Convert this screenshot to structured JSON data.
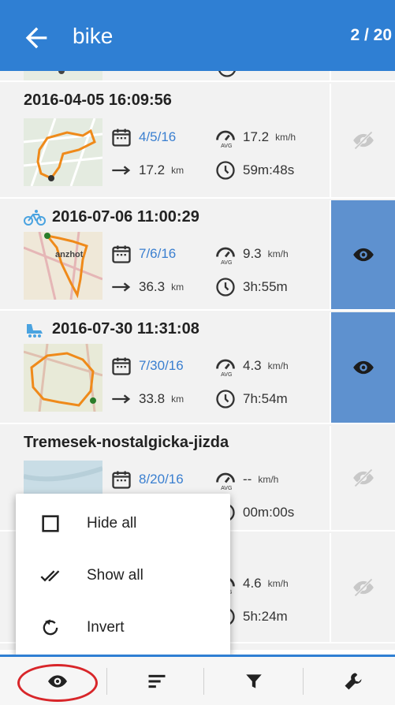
{
  "header": {
    "title": "bike",
    "count": "2 / 20"
  },
  "tracks": [
    {
      "title": "",
      "date": "",
      "speed": "",
      "speed_unit": "",
      "distance": "",
      "distance_unit": "",
      "duration": "",
      "visible": false,
      "partial": true
    },
    {
      "title": "2016-04-05 16:09:56",
      "activity": "",
      "date": "4/5/16",
      "speed": "17.2",
      "speed_unit": "km/h",
      "distance": "17.2",
      "distance_unit": "km",
      "duration": "59m:48s",
      "visible": false
    },
    {
      "title": "2016-07-06 11:00:29",
      "activity": "bike",
      "date": "7/6/16",
      "speed": "9.3",
      "speed_unit": "km/h",
      "distance": "36.3",
      "distance_unit": "km",
      "duration": "3h:55m",
      "visible": true
    },
    {
      "title": "2016-07-30 11:31:08",
      "activity": "skate",
      "date": "7/30/16",
      "speed": "4.3",
      "speed_unit": "km/h",
      "distance": "33.8",
      "distance_unit": "km",
      "duration": "7h:54m",
      "visible": true
    },
    {
      "title": "Tremesek-nostalgicka-jizda",
      "activity": "",
      "date": "8/20/16",
      "speed": "--",
      "speed_unit": "km/h",
      "distance": "",
      "distance_unit": "",
      "duration": "00m:00s",
      "visible": false
    },
    {
      "title": "",
      "activity": "",
      "date": "",
      "speed": "4.6",
      "speed_unit": "km/h",
      "distance": "",
      "distance_unit": "",
      "duration": "5h:24m",
      "visible": false
    }
  ],
  "popup_menu": [
    {
      "label": "Hide all",
      "icon": "checkbox-blank-icon"
    },
    {
      "label": "Show all",
      "icon": "double-check-icon"
    },
    {
      "label": "Invert",
      "icon": "invert-icon"
    }
  ],
  "bottom_bar": [
    {
      "name": "visibility",
      "icon": "eye-icon",
      "active": true
    },
    {
      "name": "sort",
      "icon": "sort-icon"
    },
    {
      "name": "filter",
      "icon": "filter-icon"
    },
    {
      "name": "tools",
      "icon": "wrench-icon"
    }
  ],
  "colors": {
    "accent": "#2f7fd3",
    "visible_bg": "#5e91cf",
    "date_text": "#3a7fd0",
    "highlight": "#d8262a"
  }
}
